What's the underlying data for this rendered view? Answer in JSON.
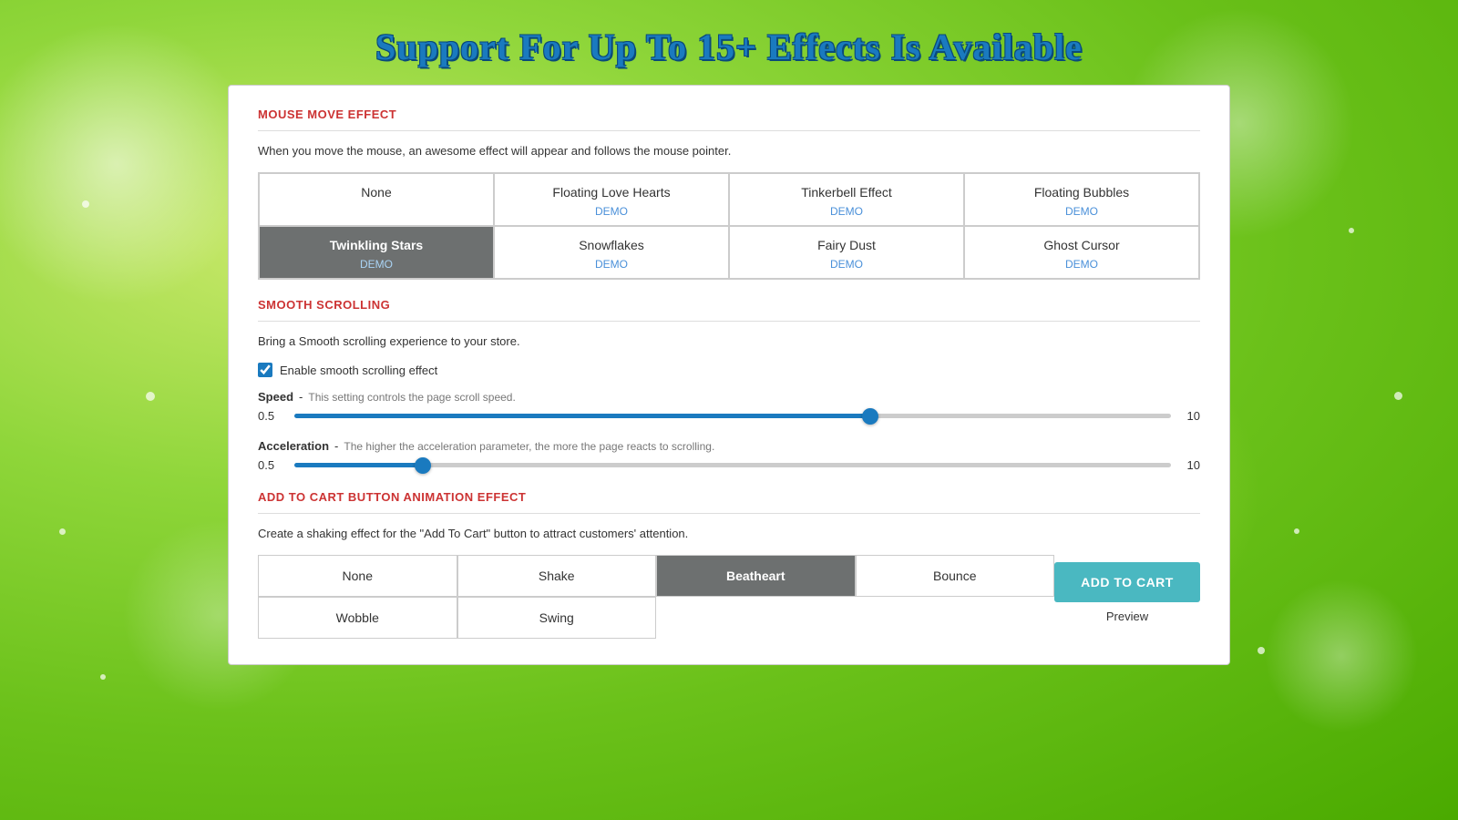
{
  "page": {
    "title": "Support For Up To 15+ Effects Is Available",
    "bg_color": "#6bc11a"
  },
  "mouse_effect": {
    "section_title": "MOUSE MOVE EFFECT",
    "description": "When you move the mouse, an awesome effect will appear and follows the mouse pointer.",
    "effects_row1": [
      {
        "id": "none",
        "label": "None",
        "demo": null,
        "selected": false
      },
      {
        "id": "floating-love-hearts",
        "label": "Floating Love Hearts",
        "demo": "DEMO",
        "selected": false
      },
      {
        "id": "tinkerbell-effect",
        "label": "Tinkerbell Effect",
        "demo": "DEMO",
        "selected": false
      },
      {
        "id": "floating-bubbles",
        "label": "Floating Bubbles",
        "demo": "DEMO",
        "selected": false
      }
    ],
    "effects_row2": [
      {
        "id": "twinkling-stars",
        "label": "Twinkling Stars",
        "demo": "DEMO",
        "selected": true
      },
      {
        "id": "snowflakes",
        "label": "Snowflakes",
        "demo": "DEMO",
        "selected": false
      },
      {
        "id": "fairy-dust",
        "label": "Fairy Dust",
        "demo": "DEMO",
        "selected": false
      },
      {
        "id": "ghost-cursor",
        "label": "Ghost Cursor",
        "demo": "DEMO",
        "selected": false
      }
    ]
  },
  "smooth_scrolling": {
    "section_title": "SMOOTH SCROLLING",
    "description": "Bring a Smooth scrolling experience to your store.",
    "enable_label": "Enable smooth scrolling effect",
    "enabled": true,
    "speed_label": "Speed",
    "speed_desc": "This setting controls the page scroll speed.",
    "speed_min": "0.5",
    "speed_max": "10",
    "speed_value": 66,
    "accel_label": "Acceleration",
    "accel_desc": "The higher the acceleration parameter, the more the page reacts to scrolling.",
    "accel_min": "0.5",
    "accel_max": "10",
    "accel_value": 14
  },
  "cart_animation": {
    "section_title": "ADD TO CART BUTTON ANIMATION EFFECT",
    "description": "Create a shaking effect for the \"Add To Cart\" button to attract customers' attention.",
    "buttons_row1": [
      {
        "id": "none",
        "label": "None",
        "selected": false
      },
      {
        "id": "shake",
        "label": "Shake",
        "selected": false
      },
      {
        "id": "beatheart",
        "label": "Beatheart",
        "selected": true
      },
      {
        "id": "bounce",
        "label": "Bounce",
        "selected": false
      }
    ],
    "buttons_row2": [
      {
        "id": "wobble",
        "label": "Wobble",
        "selected": false
      },
      {
        "id": "swing",
        "label": "Swing",
        "selected": false
      }
    ],
    "add_to_cart_label": "ADD TO CART",
    "preview_label": "Preview"
  }
}
